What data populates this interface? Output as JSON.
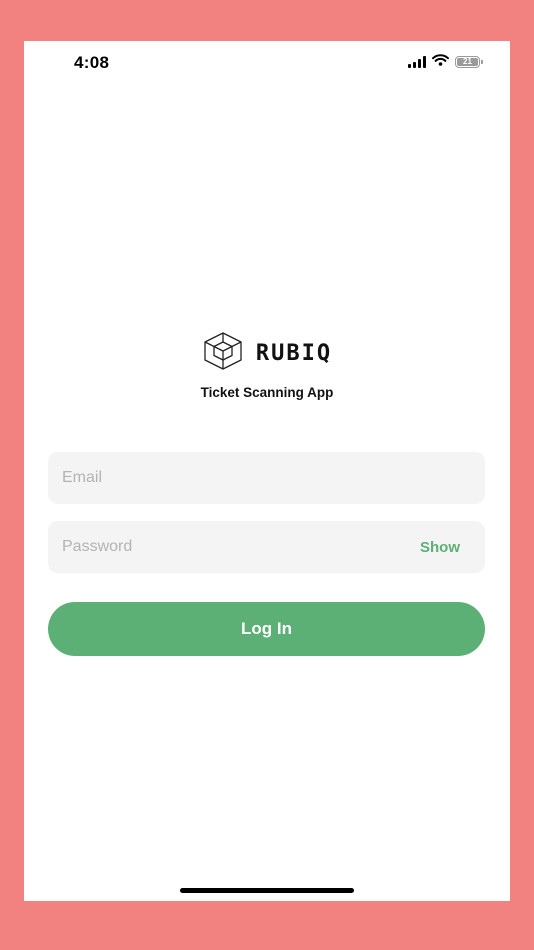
{
  "status_bar": {
    "time": "4:08",
    "battery_level": "21",
    "icons": [
      "signal-icon",
      "wifi-icon",
      "battery-icon"
    ]
  },
  "brand": {
    "name": "RUBIQ",
    "logo_icon": "cube-icon",
    "subtitle": "Ticket Scanning App"
  },
  "login_form": {
    "email": {
      "placeholder": "Email",
      "value": ""
    },
    "password": {
      "placeholder": "Password",
      "value": "",
      "show_label": "Show"
    },
    "submit_label": "Log In"
  },
  "colors": {
    "background": "#f28280",
    "accent": "#5db075",
    "field_bg": "#f4f4f4",
    "placeholder": "#b3b3b3"
  }
}
